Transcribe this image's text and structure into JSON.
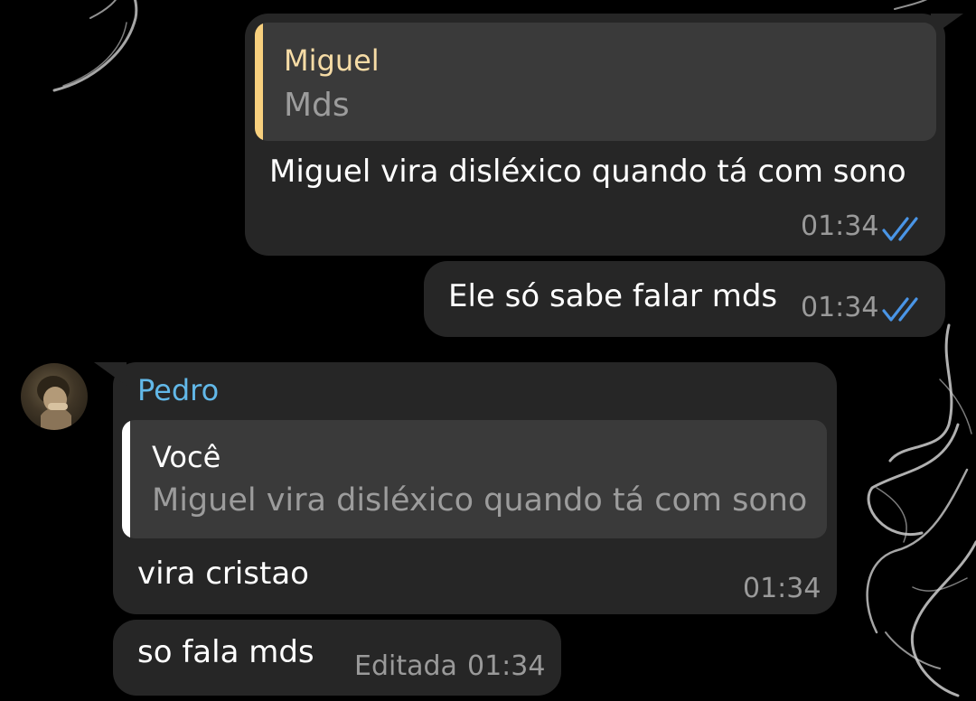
{
  "messages": [
    {
      "direction": "outgoing",
      "reply": {
        "author": "Miguel",
        "text": "Mds"
      },
      "text": "Miguel vira disléxico quando tá com sono",
      "time": "01:34",
      "status": "read-double-check"
    },
    {
      "direction": "outgoing",
      "text": "Ele só sabe falar mds",
      "time": "01:34",
      "status": "read-double-check"
    },
    {
      "direction": "incoming",
      "sender": "Pedro",
      "reply": {
        "author": "Você",
        "text": "Miguel vira disléxico quando tá com sono"
      },
      "text": "vira cristao",
      "time": "01:34"
    },
    {
      "direction": "incoming",
      "text": "so fala mds",
      "edited_label": "Editada",
      "time": "01:34"
    }
  ],
  "colors": {
    "background": "#000000",
    "bubble": "#262626",
    "reply_box": "#3a3a3a",
    "reply_bar_miguel": "#f8d07e",
    "reply_author_miguel": "#f6dca6",
    "reply_bar_voce": "#ffffff",
    "sender_pedro": "#62b8e8",
    "check_blue": "#4a95e6",
    "time_gray": "#9a9a9a"
  },
  "icons": {
    "read_status": "double-check-icon",
    "avatar": "pedro-avatar"
  }
}
